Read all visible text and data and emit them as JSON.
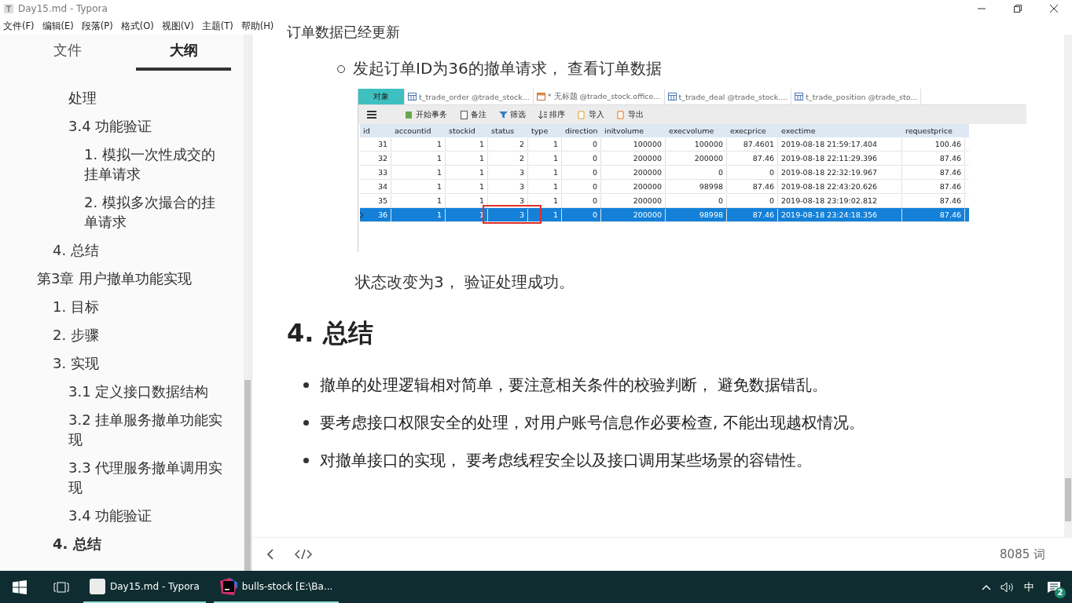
{
  "window": {
    "title": "Day15.md - Typora"
  },
  "menu": [
    "文件(F)",
    "编辑(E)",
    "段落(P)",
    "格式(O)",
    "视图(V)",
    "主题(T)",
    "帮助(H)"
  ],
  "sidebar": {
    "tabs": [
      {
        "label": "文件",
        "selected": false
      },
      {
        "label": "大纲",
        "selected": true
      }
    ],
    "outline": [
      {
        "children": [
          {
            "children": [
              {
                "label": "处理",
                "selected": false
              },
              {
                "label": "3.4 功能验证",
                "selected": false,
                "children": [
                  {
                    "label": "1. 模拟一次性成交的挂单请求",
                    "selected": false
                  },
                  {
                    "label": "2. 模拟多次撮合的挂单请求",
                    "selected": false
                  }
                ]
              }
            ]
          },
          {
            "label": "4. 总结",
            "selected": false
          }
        ]
      },
      {
        "label": "第3章 用户撤单功能实现",
        "selected": false,
        "children": [
          {
            "label": "1. 目标",
            "selected": false
          },
          {
            "label": "2. 步骤",
            "selected": false
          },
          {
            "label": "3. 实现",
            "selected": false,
            "children": [
              {
                "label": "3.1 定义接口数据结构",
                "selected": false
              },
              {
                "label": "3.2 挂单服务撤单功能实现",
                "selected": false
              },
              {
                "label": "3.3 代理服务撤单调用实现",
                "selected": false
              },
              {
                "label": "3.4 功能验证",
                "selected": false
              }
            ]
          },
          {
            "label": "4. 总结",
            "selected": true
          }
        ]
      }
    ]
  },
  "document": {
    "cut_line": "订单数据已经更新",
    "bullet": "发起订单ID为36的撤单请求， 查看订单数据",
    "embedded_screenshot": {
      "tabs": [
        {
          "label": "对象",
          "kind": "plain",
          "selected": true
        },
        {
          "label": "t_trade_order @trade_stock...",
          "kind": "table",
          "selected": false
        },
        {
          "label": "* 无标题 @trade_stock.office...",
          "kind": "query",
          "selected": false
        },
        {
          "label": "t_trade_deal @trade_stock....",
          "kind": "table",
          "selected": false
        },
        {
          "label": "t_trade_position @trade_sto...",
          "kind": "table",
          "selected": false
        }
      ],
      "toolbar": [
        {
          "label": "开始事务",
          "kind": "transaction"
        },
        {
          "label": "备注",
          "kind": "note"
        },
        {
          "label": "筛选",
          "kind": "filter"
        },
        {
          "label": "排序",
          "kind": "sort"
        },
        {
          "label": "导入",
          "kind": "import"
        },
        {
          "label": "导出",
          "kind": "export"
        }
      ],
      "columns": [
        "id",
        "accountid",
        "stockid",
        "status",
        "type",
        "direction",
        "initvolume",
        "execvolume",
        "execprice",
        "exectime",
        "requestprice"
      ],
      "rows": [
        {
          "cells": [
            "31",
            "1",
            "1",
            "2",
            "1",
            "0",
            "100000",
            "100000",
            "87.4601",
            "2019-08-18 21:59:17.404",
            "100.46"
          ],
          "selected": false,
          "status_marked": false
        },
        {
          "cells": [
            "32",
            "1",
            "1",
            "2",
            "1",
            "0",
            "200000",
            "200000",
            "87.46",
            "2019-08-18 22:11:29.396",
            "87.46"
          ],
          "selected": false,
          "status_marked": false
        },
        {
          "cells": [
            "33",
            "1",
            "1",
            "3",
            "1",
            "0",
            "200000",
            "0",
            "0",
            "2019-08-18 22:32:19.967",
            "87.46"
          ],
          "selected": false,
          "status_marked": false
        },
        {
          "cells": [
            "34",
            "1",
            "1",
            "3",
            "1",
            "0",
            "200000",
            "98998",
            "87.46",
            "2019-08-18 22:43:20.626",
            "87.46"
          ],
          "selected": false,
          "status_marked": false
        },
        {
          "cells": [
            "35",
            "1",
            "1",
            "3",
            "1",
            "0",
            "200000",
            "0",
            "0",
            "2019-08-18 23:19:02.812",
            "87.46"
          ],
          "selected": false,
          "status_marked": false
        },
        {
          "cells": [
            "36",
            "1",
            "1",
            "3",
            "1",
            "0",
            "200000",
            "98998",
            "87.46",
            "2019-08-18 23:24:18.356",
            "87.46"
          ],
          "selected": true,
          "status_marked": true
        }
      ]
    },
    "paragraph": "状态改变为3， 验证处理成功。",
    "heading": "4. 总结",
    "list": [
      "撤单的处理逻辑相对简单，要注意相关条件的校验判断， 避免数据错乱。",
      "要考虑接口权限安全的处理，对用户账号信息作必要检查, 不能出现越权情况。",
      "对撤单接口的实现， 要考虑线程安全以及接口调用某些场景的容错性。"
    ]
  },
  "footer": {
    "word_count": "8085 词"
  },
  "taskbar": {
    "apps": [
      {
        "label": "Day15.md - Typora",
        "kind": "typora"
      },
      {
        "label": "bulls-stock [E:\\Ba...",
        "kind": "ide"
      }
    ],
    "ime": "中",
    "notifications": "2"
  }
}
